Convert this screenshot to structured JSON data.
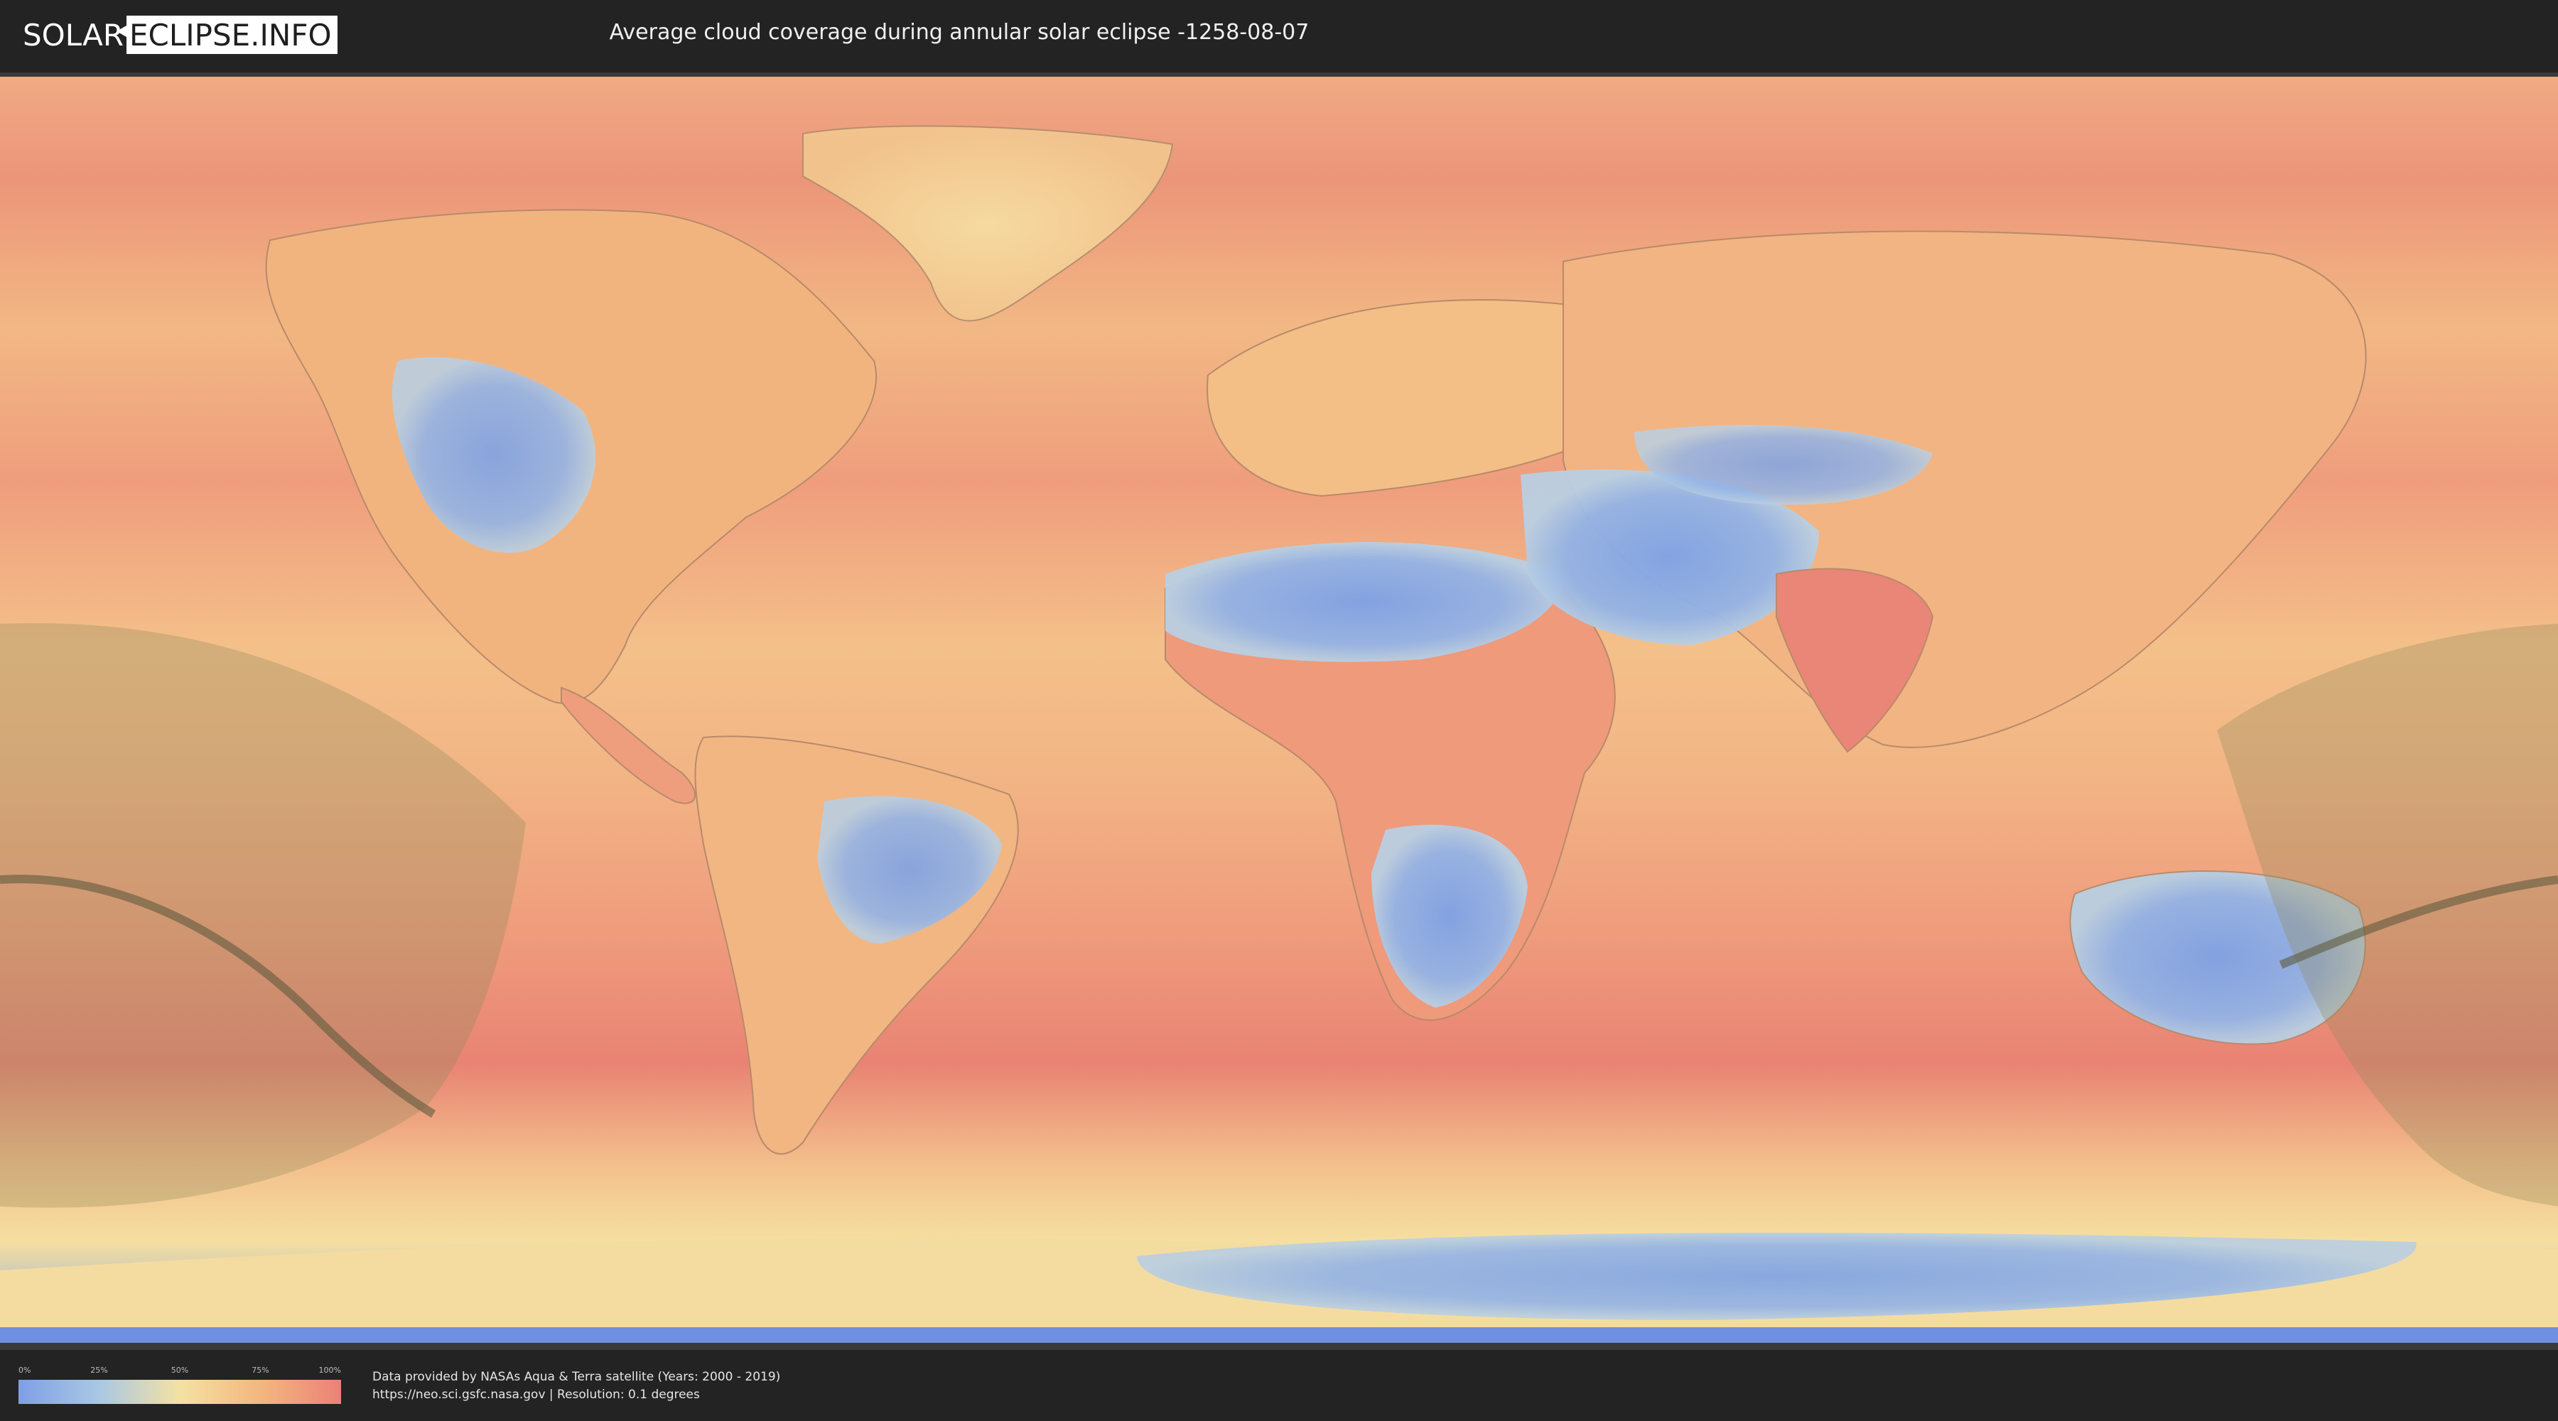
{
  "header": {
    "logo_part1": "SOLAR",
    "logo_part2": "ECLIPSE.INFO",
    "title": "Average cloud coverage during annular solar eclipse -1258-08-07"
  },
  "legend": {
    "ticks": [
      "0%",
      "25%",
      "50%",
      "75%",
      "100%"
    ],
    "colors": [
      "#7f9fe6",
      "#a9c8e4",
      "#f4e1a3",
      "#f3b77f",
      "#ec8177"
    ]
  },
  "footer": {
    "line1": "Data provided by NASAs Aqua & Terra satellite (Years: 2000 - 2019)",
    "line2": "https://neo.sci.gsfc.nasa.gov | Resolution: 0.1 degrees"
  },
  "map": {
    "ocean_color": "#eea07f",
    "high_cloud_color": "#e98376",
    "land_clear_color": "#8ea9e8",
    "eclipse_shadow_color": "#8f8a5a"
  }
}
